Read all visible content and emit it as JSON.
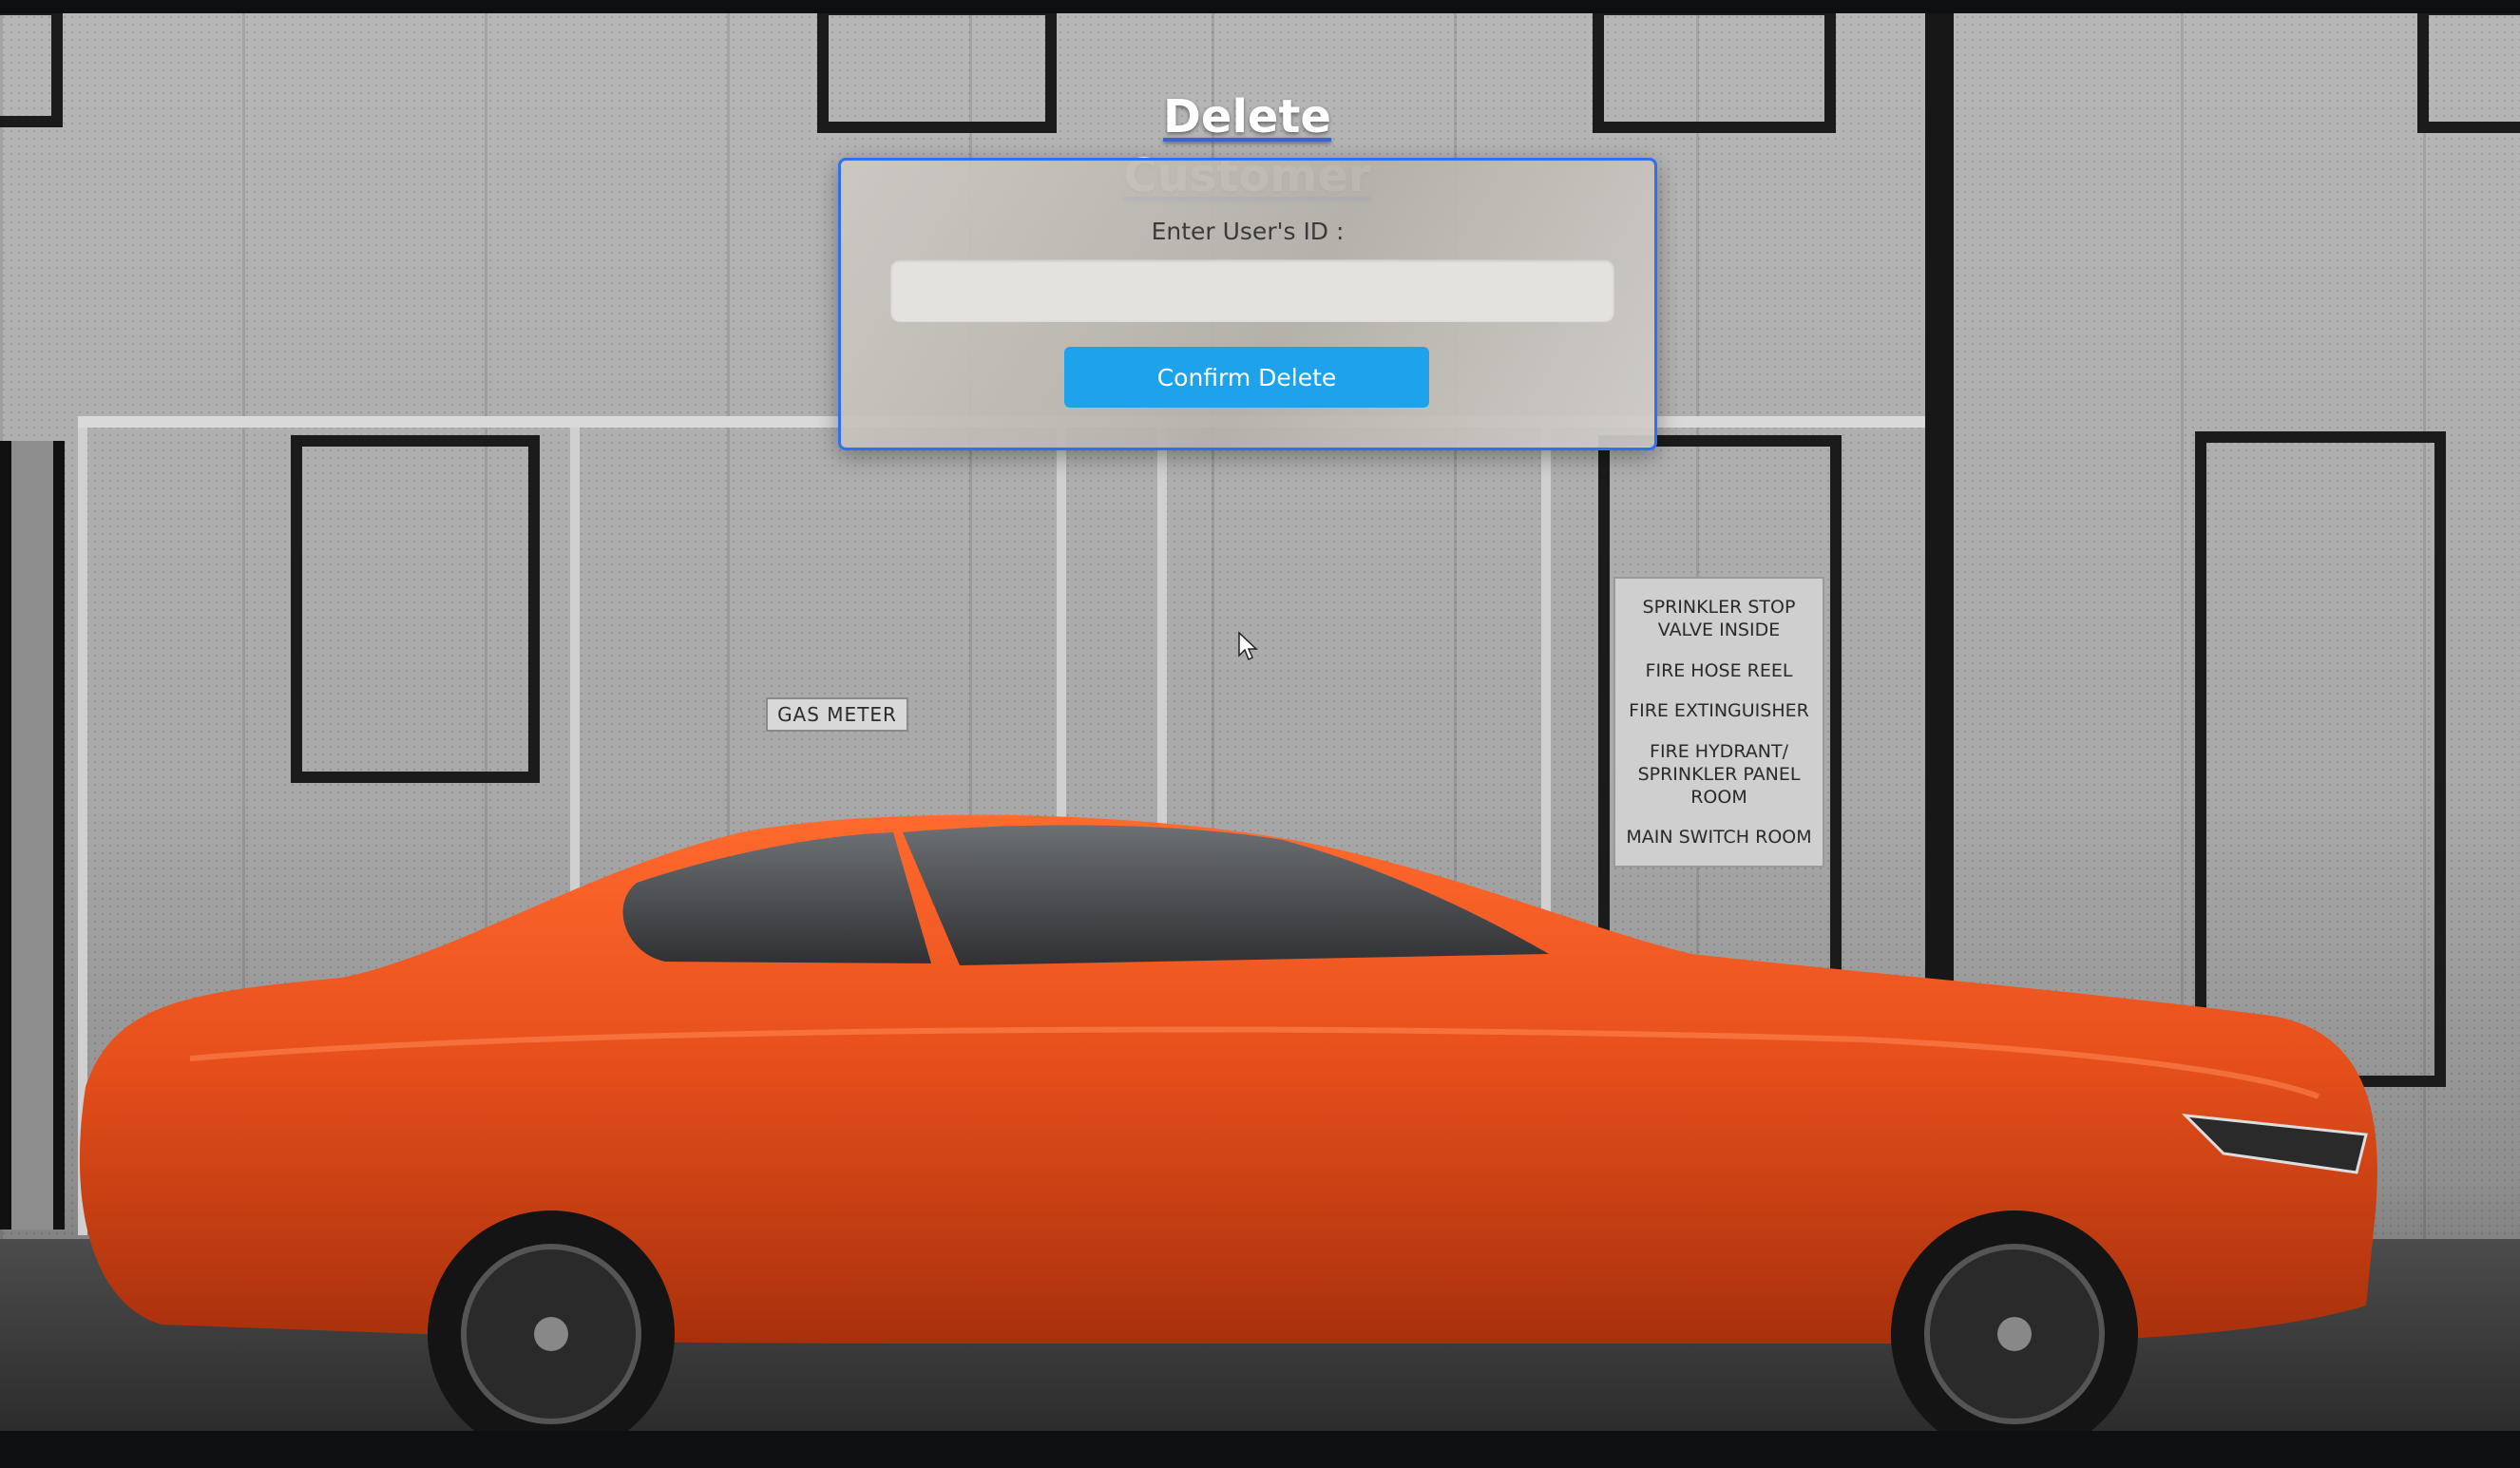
{
  "page": {
    "title": "Delete Customer"
  },
  "form": {
    "id_label": "Enter User's ID :",
    "id_value": "",
    "id_placeholder": "",
    "confirm_label": "Confirm Delete"
  },
  "background": {
    "gas_sign": "GAS METER",
    "info_sign": [
      "SPRINKLER STOP\nVALVE INSIDE",
      "FIRE HOSE REEL",
      "FIRE EXTINGUISHER",
      "FIRE HYDRANT/\nSPRINKLER PANEL ROOM",
      "MAIN SWITCH ROOM"
    ]
  },
  "colors": {
    "dialog_border": "#2f6ff2",
    "button": "#1ea2ec",
    "car": "#e8501c"
  }
}
